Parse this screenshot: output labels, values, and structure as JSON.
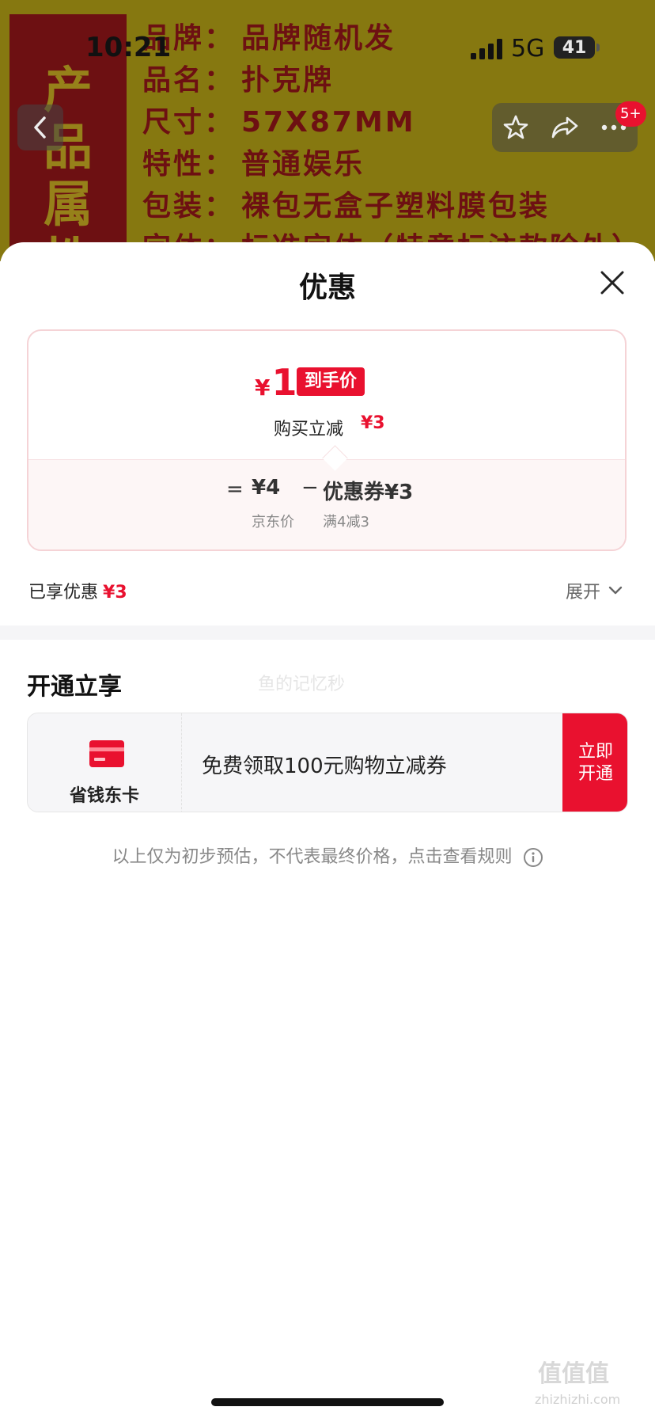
{
  "background": {
    "banner_text": [
      "产",
      "品",
      "属",
      "性"
    ],
    "attributes": [
      {
        "key": "品牌：",
        "value": "品牌随机发"
      },
      {
        "key": "品名：",
        "value": "扑克牌"
      },
      {
        "key": "尺寸：",
        "value": "57X87MM"
      },
      {
        "key": "特性：",
        "value": "普通娱乐"
      },
      {
        "key": "包装：",
        "value": "裸包无盒子塑料膜包装"
      },
      {
        "key": "字体：",
        "value": "标准字体（特意标注款除外）"
      }
    ]
  },
  "status_bar": {
    "time": "10:21",
    "network": "5G",
    "battery": "41"
  },
  "nav": {
    "badge": "5+"
  },
  "sheet": {
    "title": "优惠",
    "price": {
      "currency": "¥",
      "final": "1",
      "final_tag": "到手价",
      "instant_label": "购买立减",
      "instant_amount": "¥3",
      "eq": "=",
      "jd_price": "¥4",
      "jd_label": "京东价",
      "minus": "−",
      "coupon": "优惠券¥3",
      "coupon_rule": "满4减3"
    },
    "enjoyed_label": "已享优惠",
    "enjoyed_amount": "¥3",
    "expand_label": "展开",
    "section_title": "开通立享",
    "watermark": "鱼的记忆秒",
    "member": {
      "name": "省钱东卡",
      "text": "免费领取100元购物立减券",
      "button_line1": "立即",
      "button_line2": "开通"
    },
    "disclaimer": "以上仅为初步预估，不代表最终价格，点击查看规则"
  },
  "corner_watermark": {
    "mark": "值值值",
    "site": "zhizhizhi.com"
  },
  "colors": {
    "accent": "#e9112f",
    "bg_yellow": "#d9c21a",
    "banner_red": "#b01a1d"
  }
}
